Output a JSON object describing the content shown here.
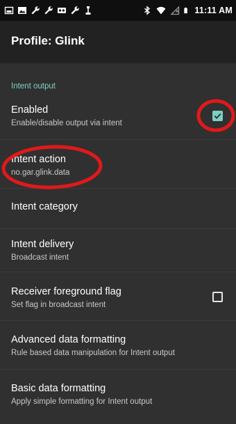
{
  "status_bar": {
    "time": "11:11 AM",
    "left_icons": [
      "image-icon",
      "gallery-icon",
      "wrench-icon",
      "wrench-icon",
      "voicemail-icon",
      "wrench-icon",
      "usb-icon"
    ],
    "right_icons": [
      "bluetooth-icon",
      "wifi-icon",
      "no-sim-icon",
      "battery-icon"
    ]
  },
  "toolbar": {
    "title": "Profile: Glink"
  },
  "section": {
    "header": "Intent output"
  },
  "preferences": [
    {
      "title": "Enabled",
      "summary": "Enable/disable output via intent",
      "checkbox": true
    },
    {
      "title": "Intent action",
      "summary": "no.gar.glink.data"
    },
    {
      "title": "Intent category"
    },
    {
      "title": "Intent delivery",
      "summary": "Broadcast intent"
    },
    {
      "title": "Receiver foreground flag",
      "summary": "Set flag in broadcast intent",
      "checkbox": false
    },
    {
      "title": "Advanced data formatting",
      "summary": "Rule based data manipulation for Intent output"
    },
    {
      "title": "Basic data formatting",
      "summary": "Apply simple formatting for Intent output"
    }
  ],
  "colors": {
    "accent": "#7ad0c3",
    "background": "#303030",
    "toolbar": "#222222",
    "annotation": "#e0191b"
  }
}
